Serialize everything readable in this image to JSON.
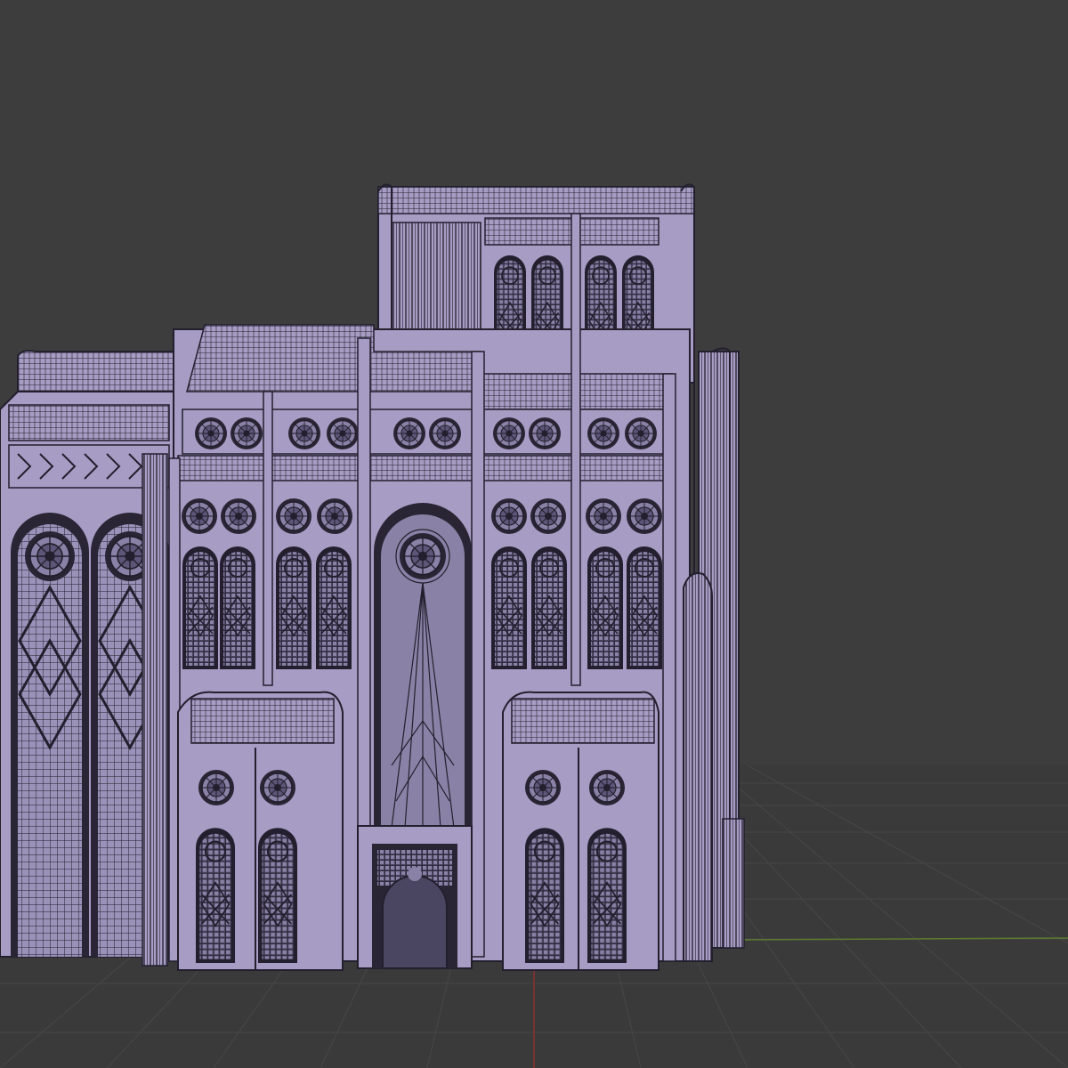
{
  "viewport": {
    "background": "#3d3d3d",
    "grid_color": "#4a4a4a",
    "x_axis_color": "#8c2e2e",
    "y_axis_color": "#5c7a2e",
    "model_fill": "#a79dc4",
    "model_wire": "#231f2e"
  }
}
